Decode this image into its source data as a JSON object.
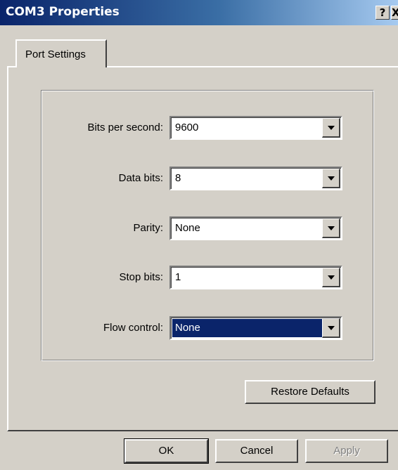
{
  "window": {
    "title": "COM3 Properties",
    "help_glyph": "?",
    "close_glyph": "X"
  },
  "tabs": [
    {
      "label": "Port Settings",
      "active": true
    }
  ],
  "port_settings": {
    "bits_per_second": {
      "label": "Bits per second:",
      "value": "9600"
    },
    "data_bits": {
      "label": "Data bits:",
      "value": "8"
    },
    "parity": {
      "label": "Parity:",
      "value": "None"
    },
    "stop_bits": {
      "label": "Stop bits:",
      "value": "1"
    },
    "flow_control": {
      "label": "Flow control:",
      "value": "None",
      "focused": true
    }
  },
  "buttons": {
    "restore_defaults": "Restore Defaults",
    "ok": "OK",
    "cancel": "Cancel",
    "apply": "Apply"
  },
  "colors": {
    "face": "#d4d0c8",
    "title_start": "#0a246a",
    "title_end": "#a6caf0",
    "selection": "#0a246a"
  }
}
